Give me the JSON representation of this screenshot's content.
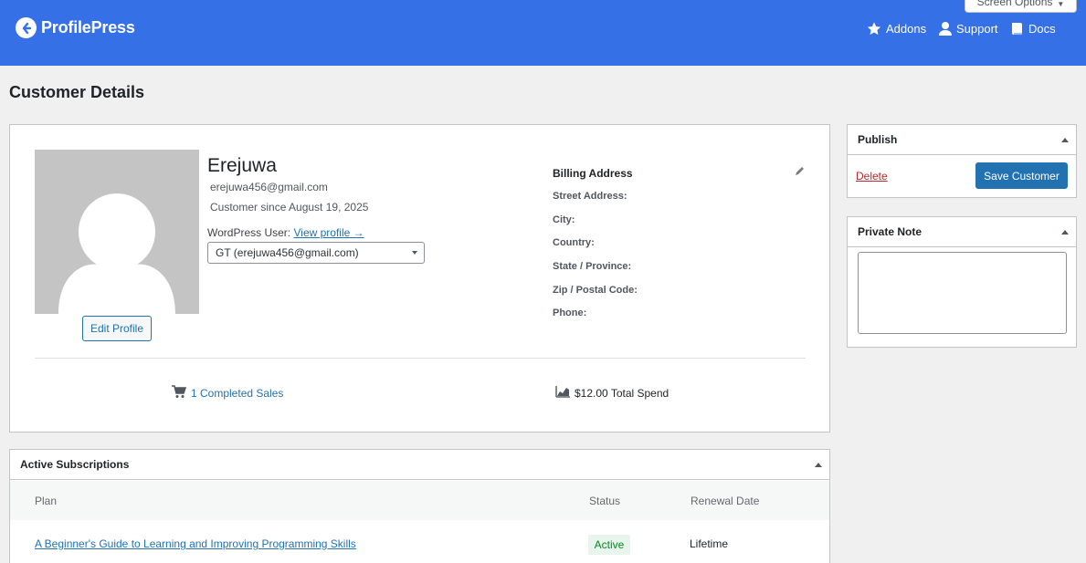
{
  "header": {
    "brand": "ProfilePress",
    "screen_options": "Screen Options",
    "nav": [
      {
        "label": "Addons",
        "icon": "star-icon"
      },
      {
        "label": "Support",
        "icon": "user-icon"
      },
      {
        "label": "Docs",
        "icon": "book-icon"
      }
    ],
    "bar_color": "#3570e6"
  },
  "page": {
    "title": "Customer Details"
  },
  "customer": {
    "name": "Erejuwa",
    "email": "erejuwa456@gmail.com",
    "since": "Customer since August 19, 2025",
    "wp_user_label": "WordPress User:",
    "view_profile": "View profile →",
    "wp_user_selected": "GT (erejuwa456@gmail.com)",
    "edit_profile": "Edit Profile"
  },
  "billing": {
    "title": "Billing Address",
    "fields": [
      "Street Address:",
      "City:",
      "Country:",
      "State / Province:",
      "Zip / Postal Code:",
      "Phone:"
    ]
  },
  "stats": {
    "sales": "1 Completed Sales",
    "spend": "$12.00 Total Spend"
  },
  "subscriptions": {
    "title": "Active Subscriptions",
    "columns": [
      "Plan",
      "Status",
      "Renewal Date"
    ],
    "rows": [
      {
        "plan": "A Beginner's Guide to Learning and Improving Programming Skills",
        "status": "Active",
        "renewal": "Lifetime"
      }
    ]
  },
  "publish": {
    "title": "Publish",
    "delete": "Delete",
    "save": "Save Customer"
  },
  "private_note": {
    "title": "Private Note",
    "value": ""
  }
}
